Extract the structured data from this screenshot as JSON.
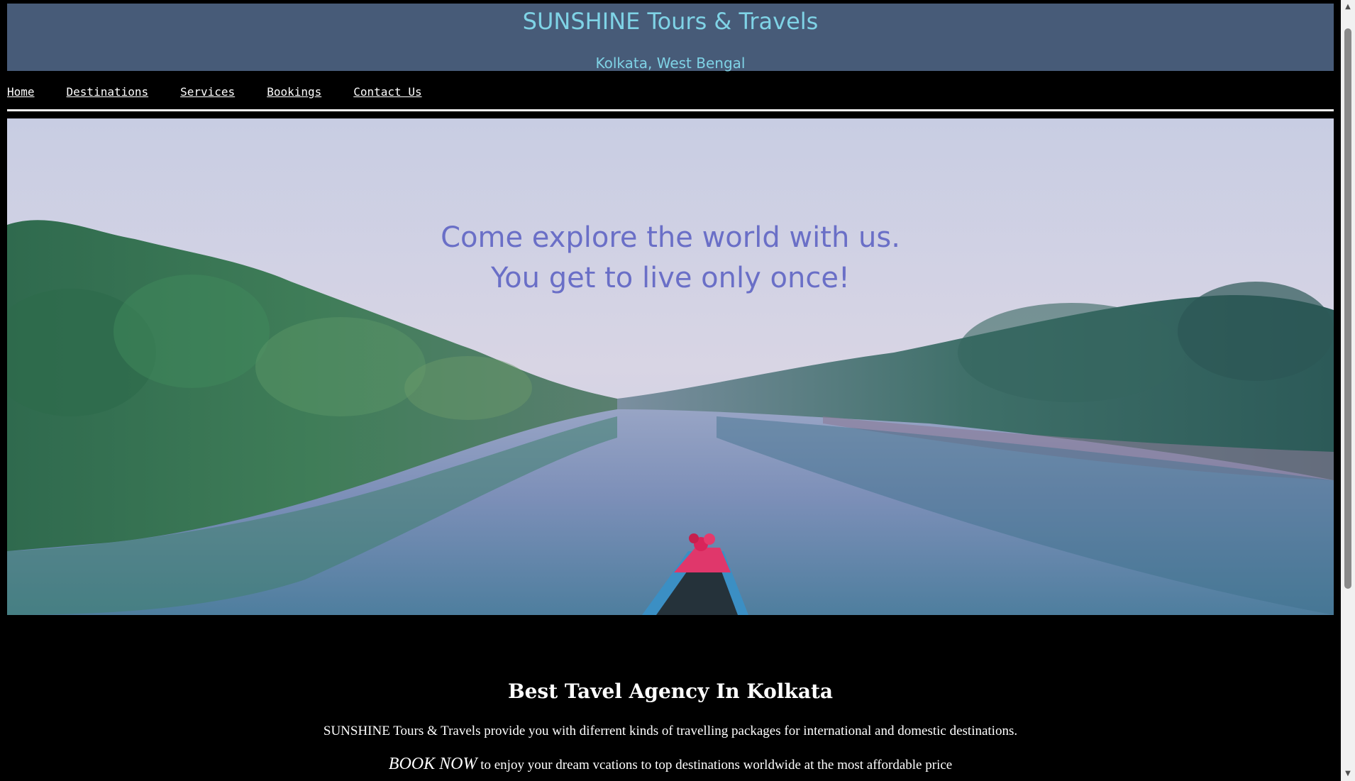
{
  "header": {
    "title": "SUNSHINE Tours & Travels",
    "subtitle": "Kolkata, West Bengal"
  },
  "nav": {
    "items": [
      {
        "label": "Home"
      },
      {
        "label": "Destinations"
      },
      {
        "label": "Services"
      },
      {
        "label": "Bookings"
      },
      {
        "label": "Contact Us"
      }
    ]
  },
  "hero": {
    "line1": "Come explore the world with us.",
    "line2": "You get to live only once!"
  },
  "content": {
    "heading": "Best Tavel Agency In Kolkata",
    "paragraph1": "SUNSHINE Tours & Travels provide you with diferrent kinds of travelling packages for international and domestic destinations.",
    "book_now": "BOOK NOW",
    "paragraph2_rest": " to enjoy your dream vcations to top destinations worldwide at the most affordable price"
  },
  "colors": {
    "header_bg": "#475b78",
    "header_text": "#7fd3e6",
    "hero_text": "#6a6fc7",
    "page_bg": "#000000"
  },
  "scrollbar": {
    "up_icon": "arrow-up-icon",
    "down_icon": "arrow-down-icon"
  }
}
